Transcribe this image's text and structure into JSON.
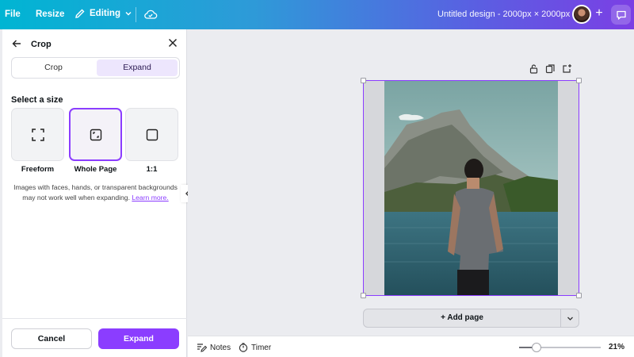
{
  "topbar": {
    "file": "File",
    "resize": "Resize",
    "editing": "Editing",
    "title": "Untitled design - 2000px × 2000px",
    "add": "+"
  },
  "panel": {
    "title": "Crop",
    "tabs": [
      {
        "label": "Crop",
        "active": false
      },
      {
        "label": "Expand",
        "active": true
      }
    ],
    "size_label": "Select a size",
    "options": [
      {
        "label": "Freeform",
        "icon": "freeform-corners-icon",
        "selected": false
      },
      {
        "label": "Whole Page",
        "icon": "whole-page-icon",
        "selected": true
      },
      {
        "label": "1:1",
        "icon": "square-icon",
        "selected": false
      }
    ],
    "hint": "Images with faces, hands, or transparent backgrounds may not work well when expanding.",
    "learn_more": "Learn more.",
    "cancel": "Cancel",
    "expand": "Expand"
  },
  "canvas": {
    "add_page": "+ Add page"
  },
  "bottombar": {
    "notes": "Notes",
    "timer": "Timer",
    "zoom": "21%",
    "zoom_level": 0.21
  },
  "colors": {
    "accent": "#8b3dff",
    "topbar_start": "#00b5d3",
    "topbar_end": "#7b3fe4"
  }
}
